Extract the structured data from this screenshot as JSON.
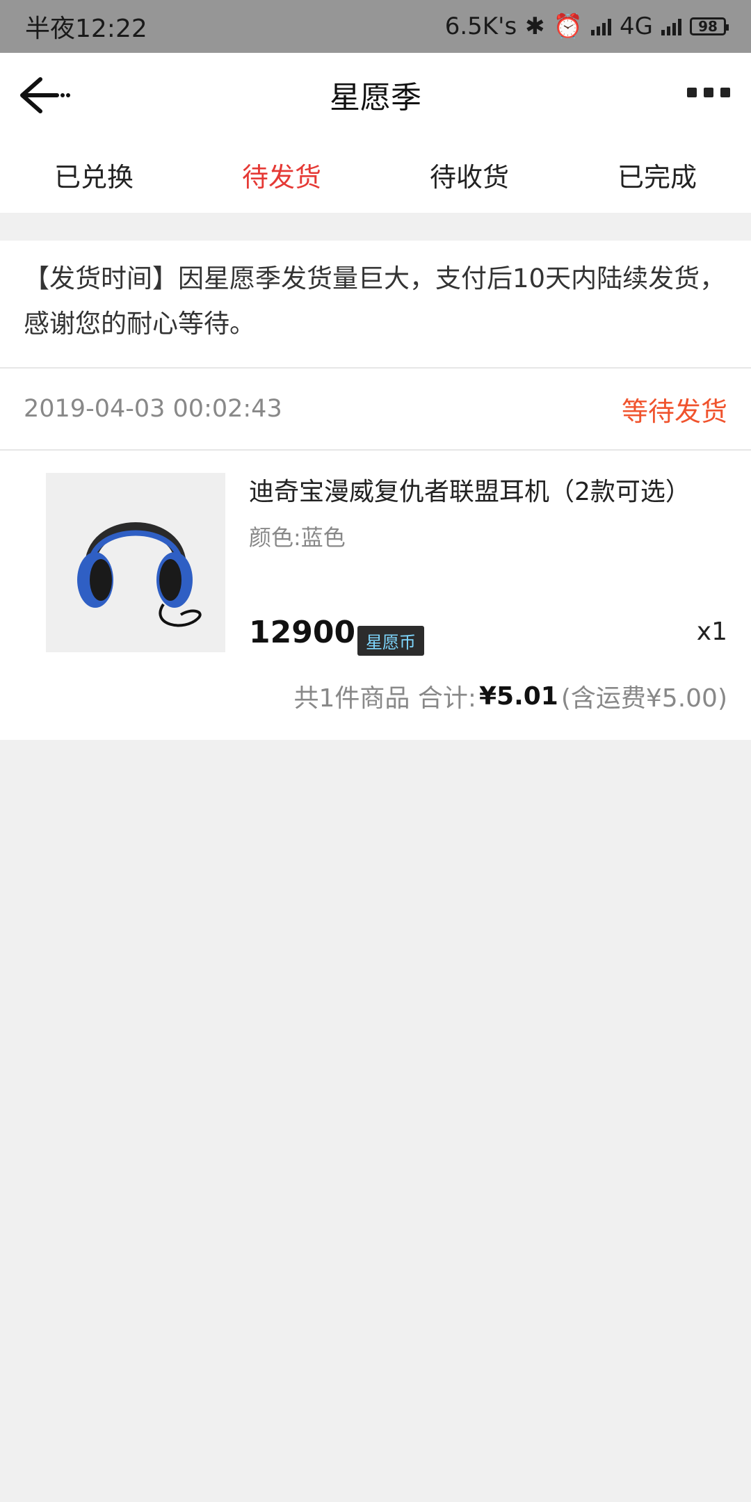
{
  "status_bar": {
    "time": "半夜12:22",
    "speed": "6.5K's",
    "network": "4G",
    "battery": "98"
  },
  "nav": {
    "title": "星愿季"
  },
  "tabs": [
    {
      "label": "已兑换",
      "active": false
    },
    {
      "label": "待发货",
      "active": true
    },
    {
      "label": "待收货",
      "active": false
    },
    {
      "label": "已完成",
      "active": false
    }
  ],
  "notice": {
    "text": "【发货时间】因星愿季发货量巨大，支付后10天内陆续发货，感谢您的耐心等待。"
  },
  "order": {
    "time": "2019-04-03 00:02:43",
    "status": "等待发货",
    "item": {
      "title": "迪奇宝漫威复仇者联盟耳机（2款可选）",
      "spec": "颜色:蓝色",
      "price": "12900",
      "currency": "星愿币",
      "quantity": "x1",
      "image": "headphones-icon"
    },
    "summary": {
      "count_text": "共1件商品 合计:",
      "total": "¥5.01",
      "shipping": "(含运费¥5.00)"
    }
  },
  "colors": {
    "accent": "#e53935",
    "status": "#f0532d"
  }
}
